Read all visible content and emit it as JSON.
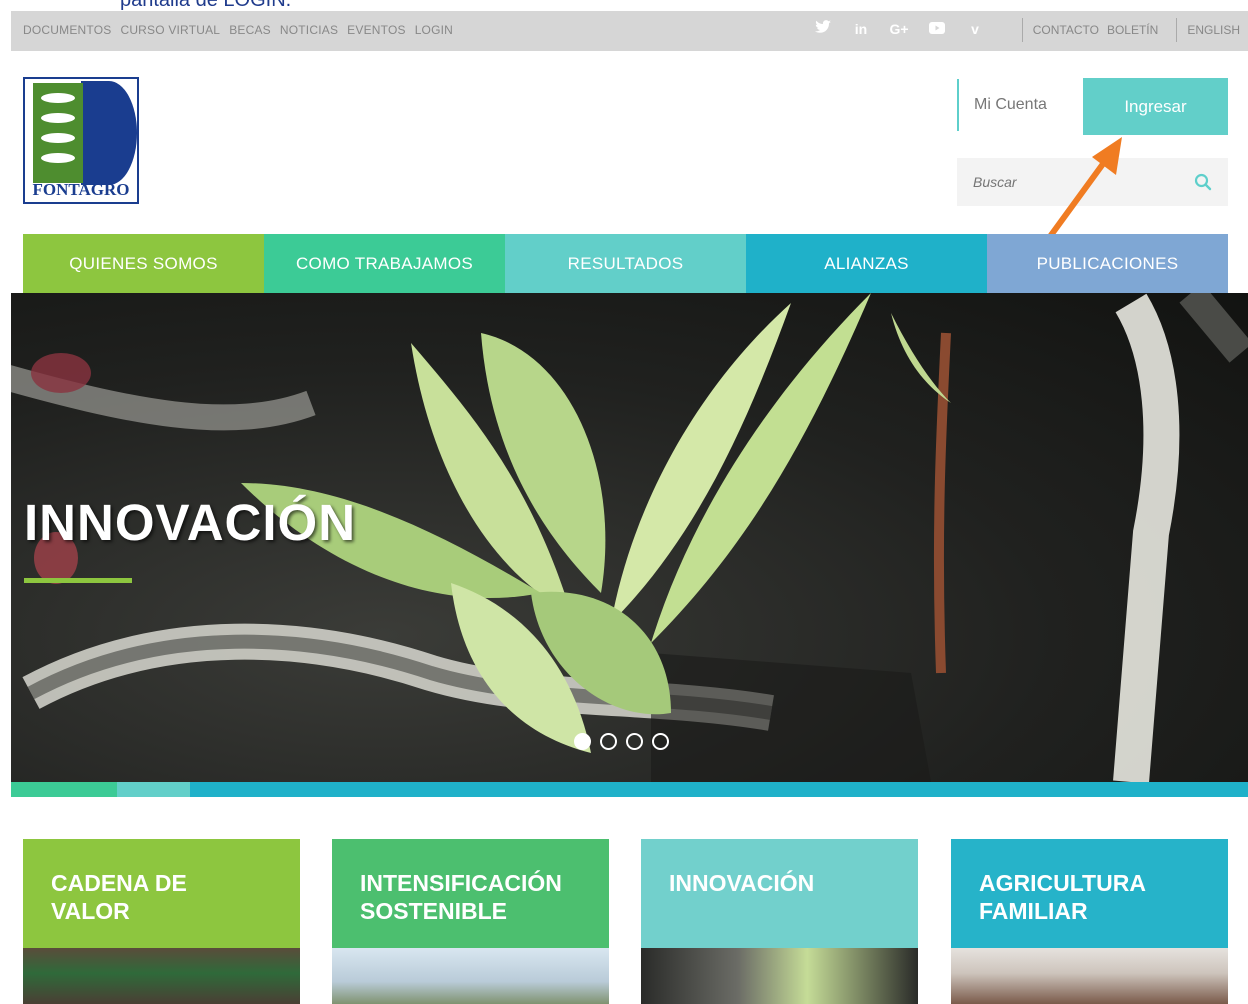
{
  "caption": "pantalla de LOGIN.",
  "top_nav": [
    "DOCUMENTOS",
    "CURSO VIRTUAL",
    "BECAS",
    "NOTICIAS",
    "EVENTOS",
    "LOGIN"
  ],
  "social": [
    {
      "icon": "twitter-icon",
      "glyph": "🐦"
    },
    {
      "icon": "linkedin-icon",
      "glyph": "in"
    },
    {
      "icon": "google-plus-icon",
      "glyph": "G+"
    },
    {
      "icon": "youtube-icon",
      "glyph": "▶"
    },
    {
      "icon": "vimeo-icon",
      "glyph": "v"
    }
  ],
  "top_right": {
    "contacto": "CONTACTO",
    "boletin": "BOLETÍN",
    "english": "ENGLISH"
  },
  "logo": {
    "name": "FONTAGRO"
  },
  "account": {
    "mi_cuenta": "Mi Cuenta",
    "ingresar": "Ingresar"
  },
  "search": {
    "placeholder": "Buscar"
  },
  "main_nav": [
    {
      "label": "QUIENES SOMOS",
      "color": "#8dc63f"
    },
    {
      "label": "COMO TRABAJAMOS",
      "color": "#3ccb96"
    },
    {
      "label": "RESULTADOS",
      "color": "#62cfc9"
    },
    {
      "label": "ALIANZAS",
      "color": "#1fb1c9"
    },
    {
      "label": "PUBLICACIONES",
      "color": "#7fa7d4"
    }
  ],
  "hero": {
    "title": "INNOVACIÓN",
    "slide_count": 4,
    "active_slide": 1
  },
  "strip_colors": [
    "#3ccb96",
    "#62cfc9",
    "#1fb1c9"
  ],
  "cards": [
    {
      "title_line1": "CADENA DE",
      "title_line2": "VALOR",
      "color": "#8dc63f"
    },
    {
      "title_line1": "INTENSIFICACIÓN",
      "title_line2": "SOSTENIBLE",
      "color": "#4cbf6f"
    },
    {
      "title_line1": "INNOVACIÓN",
      "title_line2": "",
      "color": "#72d0cc"
    },
    {
      "title_line1": "AGRICULTURA",
      "title_line2": "FAMILIAR",
      "color": "#26b3c9"
    }
  ],
  "annotation_color": "#f07c22"
}
